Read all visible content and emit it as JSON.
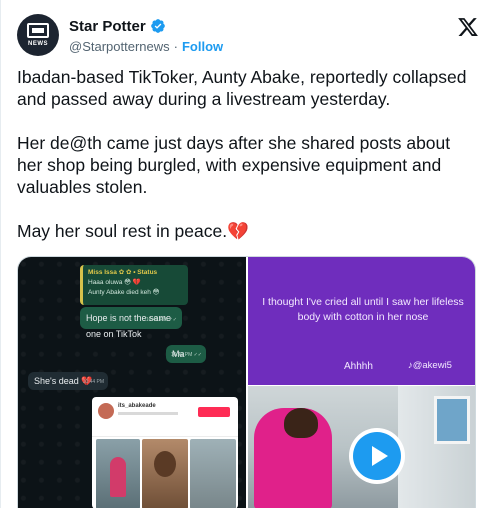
{
  "tweet": {
    "author": {
      "name": "Star Potter",
      "handle": "@Starpotternews",
      "separator": "·",
      "follow_label": "Follow",
      "avatar_text": "NEWS",
      "verified": true
    },
    "paragraphs": [
      "Ibadan-based TikToker, Aunty Abake, reportedly collapsed and passed away during a livestream yesterday.",
      "Her de@th came just days after she shared posts about her shop being burgled, with expensive equipment and valuables stolen.",
      "May her soul rest in peace.💔"
    ],
    "icons": {
      "platform": "x-logo-icon",
      "verified": "verified-badge-icon",
      "play": "play-icon"
    },
    "colors": {
      "accent": "#1d9bf0",
      "panel_purple": "#6f2dbd"
    }
  },
  "media": {
    "chat": {
      "quoted_sender": "Miss Issa ✿ ✿ • Status",
      "quoted_line1": "Haaa oluwa 😳 💔",
      "quoted_line2": "Aunty Abake died keh 😳",
      "msg1": "Hope is not the same one on TikTok",
      "msg1_time": "10:42 PM ✓✓",
      "msg2": "Ma",
      "msg2_time": "10:43 PM ✓✓",
      "msg3": "She's dead 💔",
      "msg3_time": "10:44 PM",
      "profile_name": "its_abakeade"
    },
    "overlay": {
      "caption": "I thought I've cried all until I saw her lifeless body with cotton in her nose",
      "sound": "Ahhhh",
      "tiktok_handle": "♪@akewi5"
    }
  }
}
